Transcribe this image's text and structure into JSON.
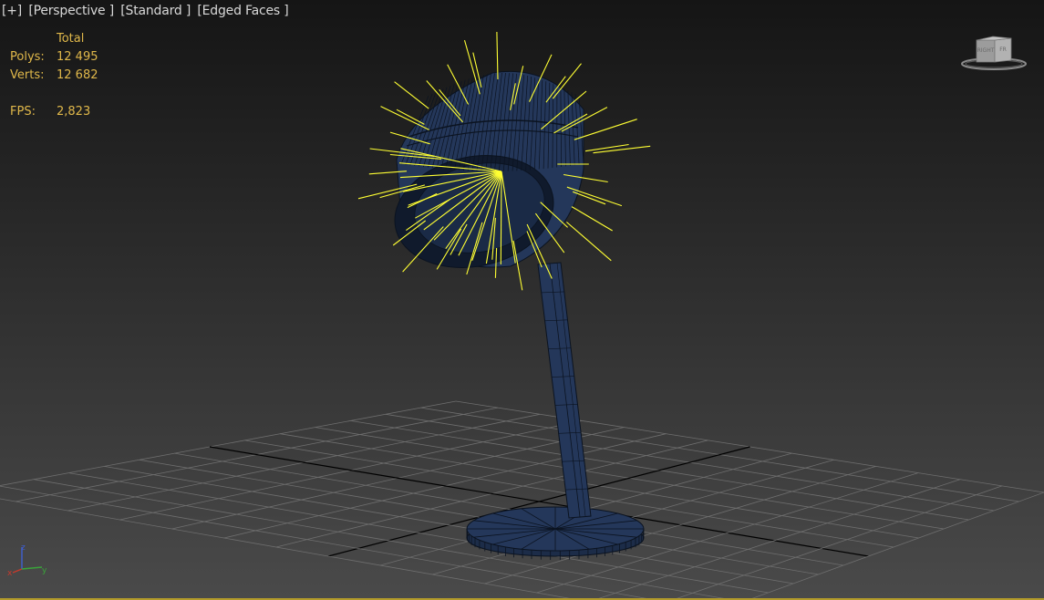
{
  "viewport": {
    "labels": {
      "menu": "[+]",
      "view": "[Perspective ]",
      "shading": "[Standard ]",
      "display": "[Edged Faces ]"
    },
    "stats": {
      "header": "Total",
      "polys_label": "Polys:",
      "polys_value": "12 495",
      "verts_label": "Verts:",
      "verts_value": "12 682",
      "fps_label": "FPS:",
      "fps_value": "2,823"
    },
    "viewcube": {
      "left_face": "RIGHT",
      "right_face": "FR"
    },
    "axes": {
      "x": "x",
      "y": "y",
      "z": "z"
    }
  },
  "colors": {
    "stats_text": "#e0b84a",
    "label_text": "#d8d8d8",
    "mesh_fill": "#24375a",
    "mesh_edge": "#0b1320",
    "light_rays": "#ffff33",
    "grid_line": "#6e6e6e",
    "grid_axis": "#000000",
    "viewport_border": "#b39b2b"
  },
  "icons": {
    "viewcube": "viewcube-icon",
    "axis_tripod": "axis-tripod-icon"
  }
}
